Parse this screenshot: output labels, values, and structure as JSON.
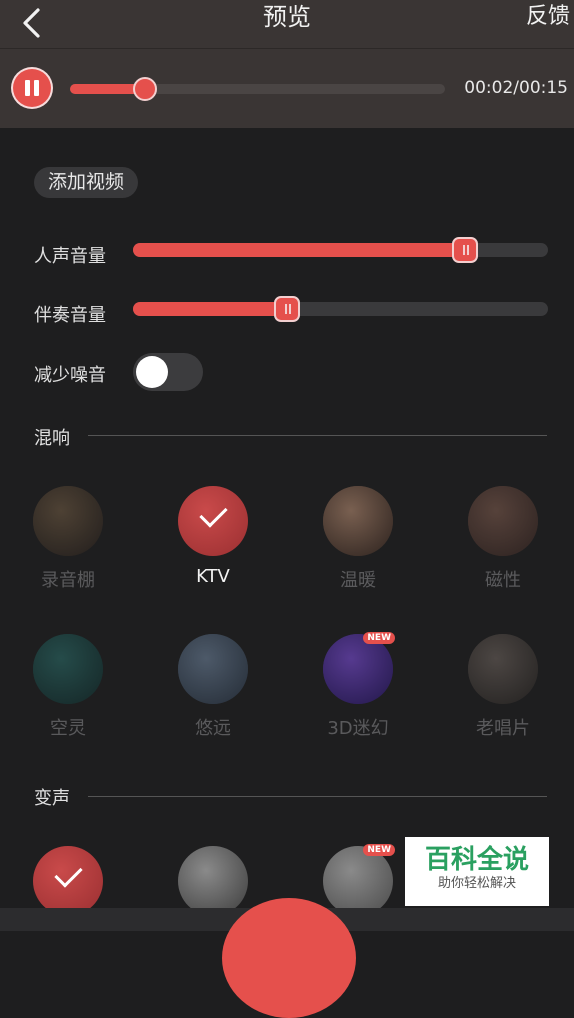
{
  "header": {
    "title": "预览",
    "feedback": "反馈"
  },
  "player": {
    "time": "00:02/00:15",
    "progress": 0.2
  },
  "add_video": "添加视频",
  "controls": {
    "vocal": {
      "label": "人声音量",
      "value": 0.8
    },
    "accompaniment": {
      "label": "伴奏音量",
      "value": 0.37
    },
    "noise": {
      "label": "减少噪音",
      "enabled": false
    }
  },
  "reverb": {
    "title": "混响",
    "items": [
      {
        "label": "录音棚",
        "selected": false,
        "new": false,
        "colors": [
          "#6d5a44",
          "#2a2420"
        ]
      },
      {
        "label": "KTV",
        "selected": true,
        "new": false,
        "colors": [
          "#c94a4a",
          "#9a2f31"
        ]
      },
      {
        "label": "温暖",
        "selected": false,
        "new": false,
        "colors": [
          "#b08970",
          "#3a2a22"
        ]
      },
      {
        "label": "磁性",
        "selected": false,
        "new": false,
        "colors": [
          "#7a5b4e",
          "#3a2a26"
        ]
      },
      {
        "label": "空灵",
        "selected": false,
        "new": false,
        "colors": [
          "#2f6a66",
          "#16302f"
        ]
      },
      {
        "label": "悠远",
        "selected": false,
        "new": false,
        "colors": [
          "#6c7f95",
          "#2e3a48"
        ]
      },
      {
        "label": "3D迷幻",
        "selected": false,
        "new": true,
        "colors": [
          "#7a4fd0",
          "#2a1a66"
        ]
      },
      {
        "label": "老唱片",
        "selected": false,
        "new": false,
        "colors": [
          "#6b625c",
          "#2c2926"
        ]
      }
    ]
  },
  "voice_change": {
    "title": "变声",
    "items": [
      {
        "selected": true,
        "new": false,
        "colors": [
          "#c94a4a",
          "#9a2f31"
        ]
      },
      {
        "selected": false,
        "new": false,
        "colors": [
          "#8a8a8a",
          "#3c3c3c"
        ]
      },
      {
        "selected": false,
        "new": true,
        "colors": [
          "#8a8a8a",
          "#4a4a4a"
        ]
      }
    ]
  },
  "new_badge": "NEW",
  "watermark": {
    "title": "百科全说",
    "subtitle": "助你轻松解决"
  }
}
